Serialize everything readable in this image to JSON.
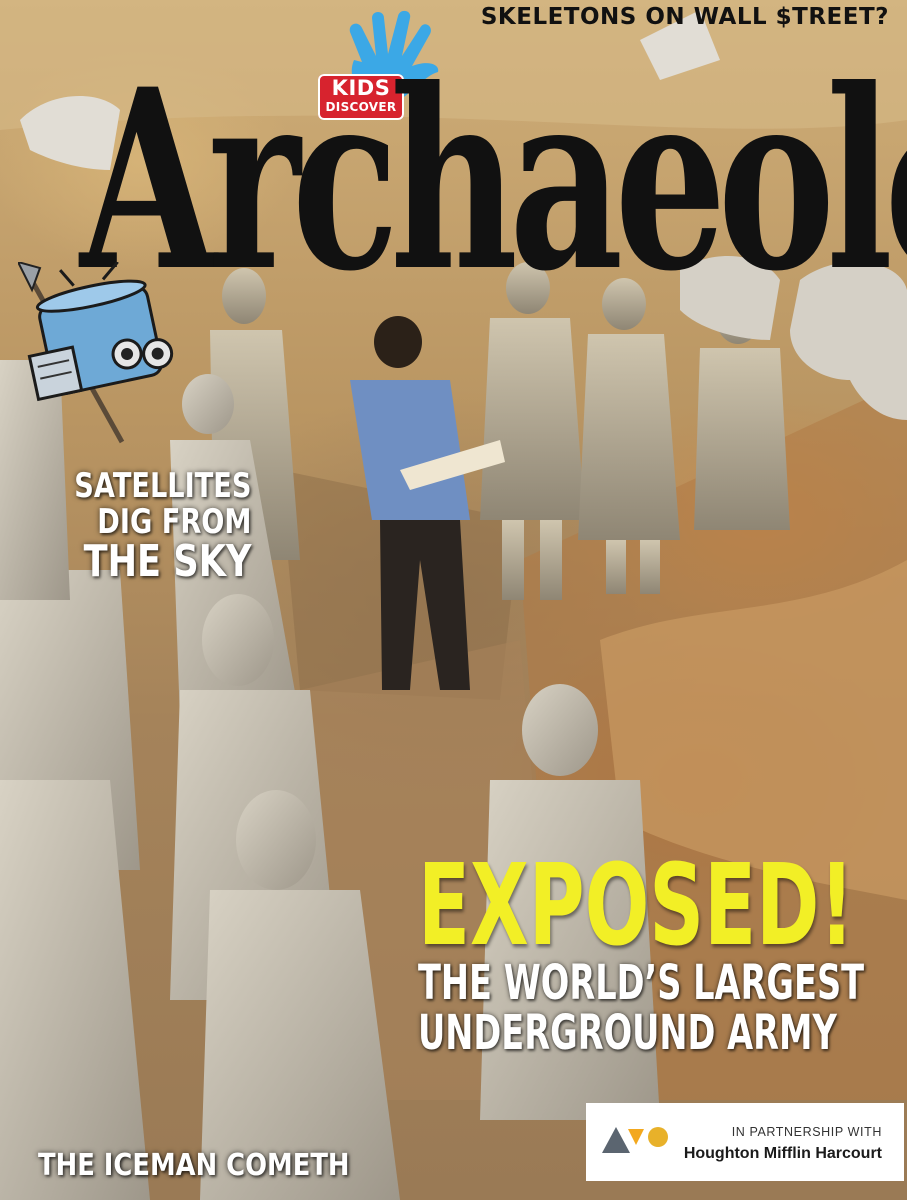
{
  "brand": {
    "kids": "KIDS",
    "discover": "DISCOVER",
    "title": "Archaeology",
    "colors": {
      "badge_red": "#d7232e",
      "hand_blue": "#3ba8e6",
      "headline_yellow": "#f2ef26"
    }
  },
  "headlines": {
    "top": "SKELETONS ON WALL $TREET?",
    "satellites": [
      "SATELLITES",
      "DIG FROM",
      "THE SKY"
    ],
    "exposed": "EXPOSED!",
    "subhead": [
      "THE WORLD’S LARGEST",
      "UNDERGROUND ARMY"
    ],
    "bottom": "THE ICEMAN COMETH"
  },
  "partner": {
    "label": "IN PARTNERSHIP WITH",
    "name": "Houghton Mifflin Harcourt",
    "logo_colors": [
      "#5b6570",
      "#f3a81e",
      "#e8b12a"
    ]
  },
  "icons": {
    "hand": "kids-discover-hand-icon",
    "satellite": "satellite-cartoon-icon",
    "partner_logo": "hmh-logo-icon"
  }
}
